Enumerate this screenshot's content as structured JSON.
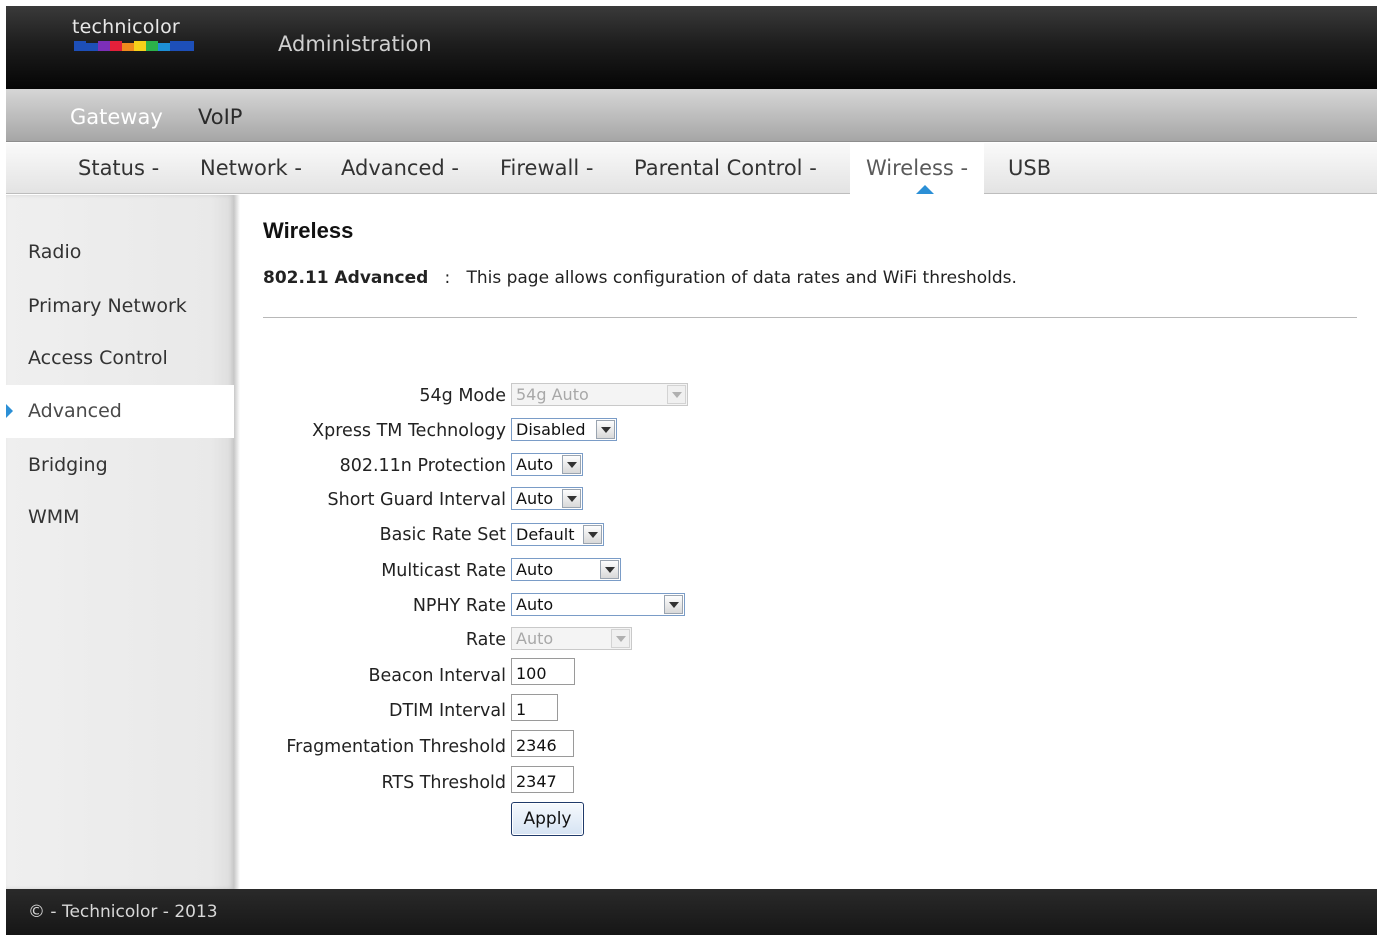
{
  "header": {
    "logo_text": "technicolor",
    "logo_colors": [
      "#1d4fb8",
      "#1d4fb8",
      "#7c2fb8",
      "#e3203a",
      "#f08a1d",
      "#f6d11a",
      "#2bb24a",
      "#1d8fd6",
      "#1d4fb8",
      "#1d4fb8"
    ],
    "title": "Administration"
  },
  "topnav": {
    "items": [
      "Gateway",
      "VoIP"
    ],
    "active": "Gateway"
  },
  "subnav": {
    "items": [
      "Status -",
      "Network -",
      "Advanced -",
      "Firewall -",
      "Parental Control -",
      "Wireless -",
      "USB"
    ],
    "active": "Wireless -",
    "accent_color": "#2b8fd6"
  },
  "sidebar": {
    "items": [
      "Radio",
      "Primary Network",
      "Access Control",
      "Advanced",
      "Bridging",
      "WMM"
    ],
    "active": "Advanced"
  },
  "main": {
    "title": "Wireless",
    "desc_bold": "802.11 Advanced",
    "desc_sep": ":",
    "desc_text": "This page allows configuration of data rates and WiFi thresholds."
  },
  "form": {
    "mode54g": {
      "label": "54g Mode",
      "value": "54g Auto",
      "disabled": true
    },
    "xpress": {
      "label": "Xpress TM Technology",
      "value": "Disabled"
    },
    "protection": {
      "label": "802.11n Protection",
      "value": "Auto"
    },
    "guard": {
      "label": "Short Guard Interval",
      "value": "Auto"
    },
    "basic_rate": {
      "label": "Basic Rate Set",
      "value": "Default"
    },
    "multicast": {
      "label": "Multicast Rate",
      "value": "Auto"
    },
    "nphy": {
      "label": "NPHY Rate",
      "value": "Auto"
    },
    "rate": {
      "label": "Rate",
      "value": "Auto",
      "disabled": true
    },
    "beacon": {
      "label": "Beacon Interval",
      "value": "100"
    },
    "dtim": {
      "label": "DTIM Interval",
      "value": "1"
    },
    "frag": {
      "label": "Fragmentation Threshold",
      "value": "2346"
    },
    "rts": {
      "label": "RTS Threshold",
      "value": "2347"
    },
    "apply_label": "Apply"
  },
  "footer": {
    "text": "© - Technicolor - 2013"
  }
}
